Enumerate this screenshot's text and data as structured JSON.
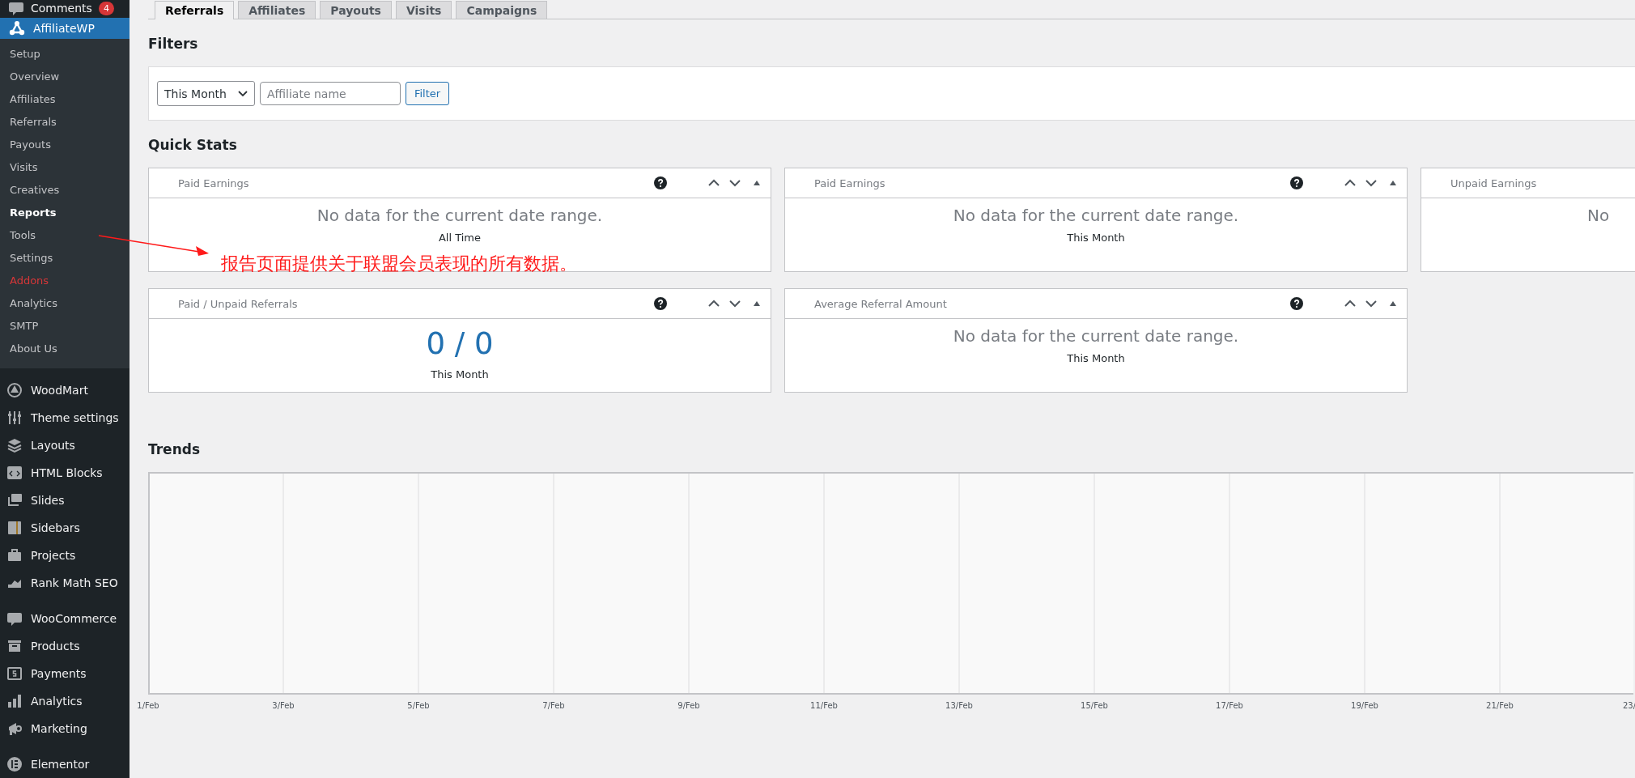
{
  "sidebar": {
    "comments": {
      "label": "Comments",
      "badge": "4",
      "selected": false
    },
    "plugin": {
      "label": "AffiliateWP",
      "selected": true
    },
    "submenu": [
      {
        "label": "Setup",
        "selected": false
      },
      {
        "label": "Overview",
        "selected": false
      },
      {
        "label": "Affiliates",
        "selected": false
      },
      {
        "label": "Referrals",
        "selected": false
      },
      {
        "label": "Payouts",
        "selected": false
      },
      {
        "label": "Visits",
        "selected": false
      },
      {
        "label": "Creatives",
        "selected": false
      },
      {
        "label": "Reports",
        "selected": true
      },
      {
        "label": "Tools",
        "selected": false
      },
      {
        "label": "Settings",
        "selected": false
      },
      {
        "label": "Addons",
        "selected": false,
        "color": "#d63638"
      },
      {
        "label": "Analytics",
        "selected": false
      },
      {
        "label": "SMTP",
        "selected": false
      },
      {
        "label": "About Us",
        "selected": false
      }
    ],
    "menu_groups": [
      {
        "items": [
          "WoodMart",
          "Theme settings",
          "Layouts",
          "HTML Blocks",
          "Slides",
          "Sidebars",
          "Projects",
          "Rank Math SEO"
        ]
      },
      {
        "items": [
          "WooCommerce",
          "Products",
          "Payments",
          "Analytics",
          "Marketing"
        ]
      },
      {
        "items": [
          "Elementor"
        ]
      }
    ]
  },
  "tabs": [
    {
      "label": "Referrals",
      "selected": true
    },
    {
      "label": "Affiliates",
      "selected": false
    },
    {
      "label": "Payouts",
      "selected": false
    },
    {
      "label": "Visits",
      "selected": false
    },
    {
      "label": "Campaigns",
      "selected": false
    }
  ],
  "filters": {
    "heading": "Filters",
    "range": "This Month",
    "affiliate": {
      "placeholder": "Affiliate name"
    },
    "button": "Filter"
  },
  "quick_stats": {
    "heading": "Quick Stats",
    "rows": [
      {
        "cards": [
          {
            "title": "Paid Earnings",
            "kind": "message",
            "text": "No data for the current date range.",
            "period": "All Time",
            "clipped": false
          },
          {
            "title": "Paid Earnings",
            "kind": "message",
            "text": "No data for the current date range.",
            "period": "This Month",
            "clipped": false
          },
          {
            "title": "Unpaid Earnings",
            "kind": "message",
            "text": "No",
            "clipped": true
          }
        ]
      },
      {
        "cards": [
          {
            "title": "Paid / Unpaid Referrals",
            "kind": "value",
            "text": "0 / 0",
            "period": "This Month",
            "clipped": false
          },
          {
            "title": "Average Referral Amount",
            "kind": "message",
            "text": "No data for the current date range.",
            "period": "This Month",
            "clipped": false
          }
        ]
      }
    ]
  },
  "trends": {
    "heading": "Trends",
    "x_labels": [
      "1/Feb",
      "3/Feb",
      "5/Feb",
      "7/Feb",
      "9/Feb",
      "11/Feb",
      "13/Feb",
      "15/Feb",
      "17/Feb",
      "19/Feb",
      "21/Feb",
      "23/"
    ]
  },
  "annotation": {
    "text": "报告页面提供关于联盟会员表现的所有数据。"
  }
}
